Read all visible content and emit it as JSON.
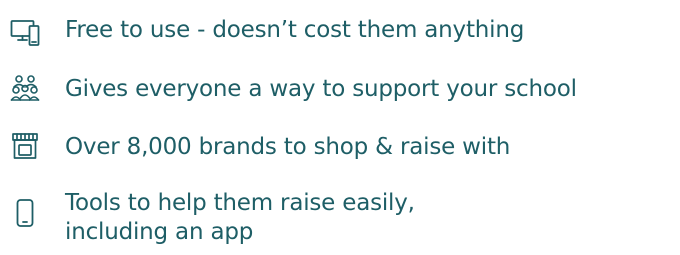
{
  "features": [
    {
      "icon": "computer-monitor-icon",
      "text": "Free to use - doesn’t cost them anything"
    },
    {
      "icon": "group-of-people-icon",
      "text": "Gives everyone a way to support your school"
    },
    {
      "icon": "shop-storefront-icon",
      "text": "Over 8,000 brands to shop & raise with"
    },
    {
      "icon": "mobile-phone-icon",
      "lines": [
        "Tools to help them raise easily,",
        "including an app"
      ]
    }
  ],
  "colors": {
    "text": "#1e5e66",
    "icon": "#1e5e66"
  }
}
